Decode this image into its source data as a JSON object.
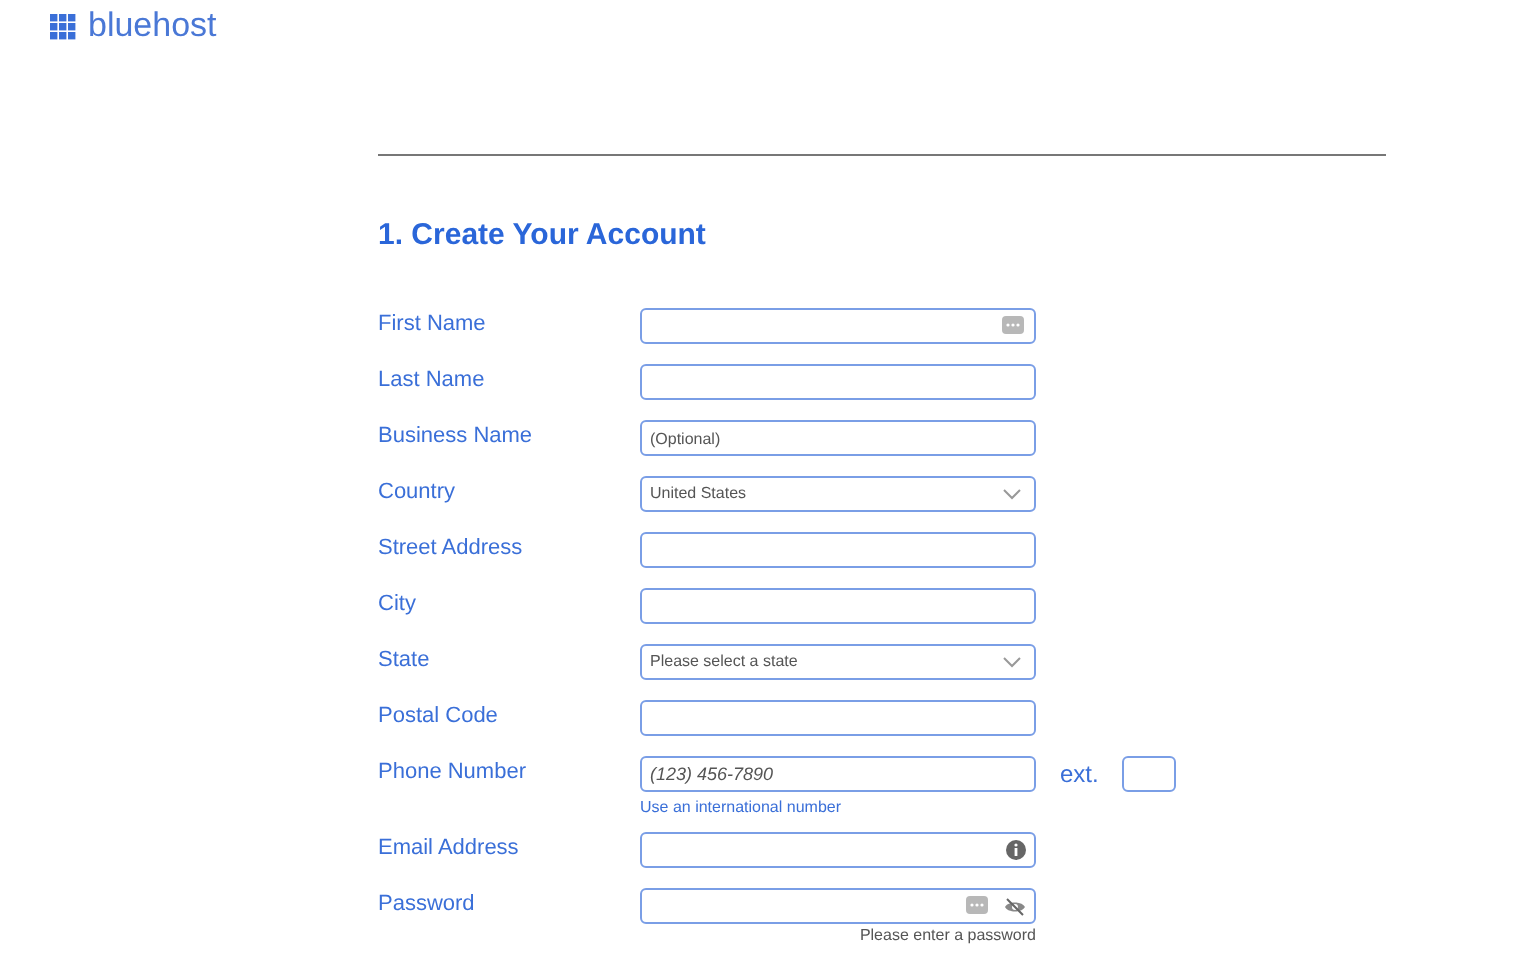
{
  "logo": {
    "text": "bluehost"
  },
  "section": {
    "title": "1. Create Your Account"
  },
  "fields": [
    {
      "label": "First Name",
      "kind": "text",
      "autofill_icon": true
    },
    {
      "label": "Last Name",
      "kind": "text"
    },
    {
      "label": "Business Name",
      "kind": "text",
      "placeholder": "(Optional)"
    },
    {
      "label": "Country",
      "kind": "select",
      "value": "United States"
    },
    {
      "label": "Street Address",
      "kind": "text"
    },
    {
      "label": "City",
      "kind": "text"
    },
    {
      "label": "State",
      "kind": "select",
      "value": "Please select a state"
    },
    {
      "label": "Postal Code",
      "kind": "text"
    },
    {
      "label": "Phone Number",
      "kind": "phone",
      "placeholder": "(123) 456-7890",
      "ext_label": "ext.",
      "link": "Use an international number"
    },
    {
      "label": "Email Address",
      "kind": "email"
    },
    {
      "label": "Password",
      "kind": "password",
      "autofill_icon": true,
      "hint": "Please enter a password"
    }
  ]
}
